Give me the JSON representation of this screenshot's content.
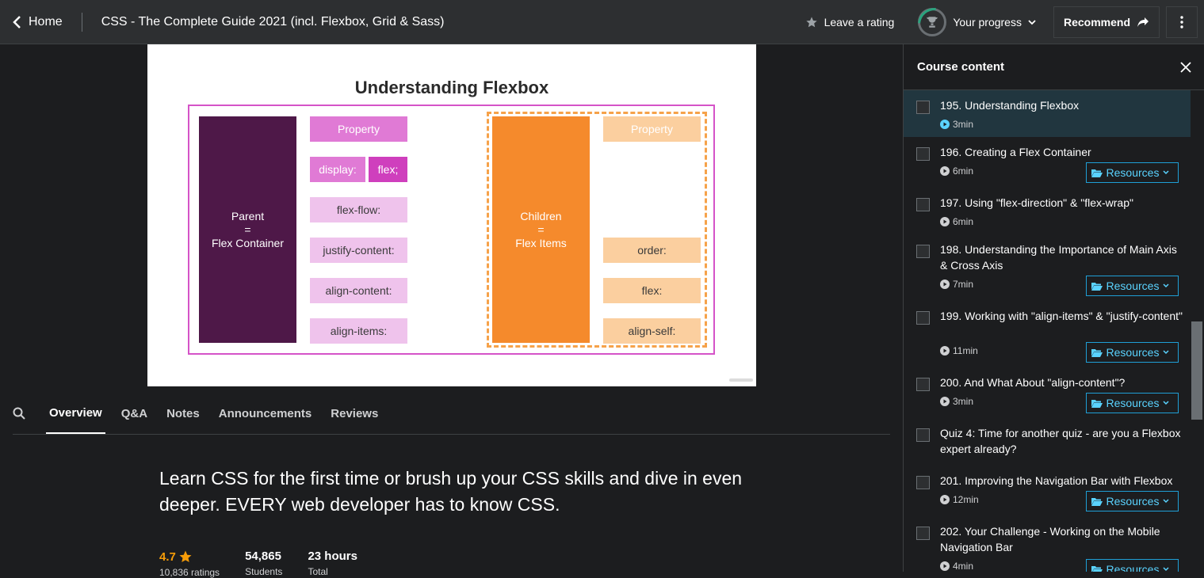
{
  "header": {
    "home_label": "Home",
    "course_title": "CSS - The Complete Guide 2021 (incl. Flexbox, Grid & Sass)",
    "rating_label": "Leave a rating",
    "progress_label": "Your progress",
    "recommend_label": "Recommend"
  },
  "slide": {
    "title": "Understanding Flexbox",
    "parent_line1": "Parent",
    "parent_line2": "=",
    "parent_line3": "Flex Container",
    "parent_property_header": "Property",
    "parent_props": [
      "display:",
      "flex;",
      "flex-flow:",
      "justify-content:",
      "align-content:",
      "align-items:"
    ],
    "children_line1": "Children",
    "children_line2": "=",
    "children_line3": "Flex Items",
    "children_property_header": "Property",
    "children_props": [
      "order:",
      "flex:",
      "align-self:"
    ]
  },
  "tabs": [
    "Overview",
    "Q&A",
    "Notes",
    "Announcements",
    "Reviews"
  ],
  "overview": {
    "headline": "Learn CSS for the first time or brush up your CSS skills and dive in even deeper. EVERY web developer has to know CSS.",
    "rating_value": "4.7",
    "rating_count": "10,836 ratings",
    "students_value": "54,865",
    "students_label": "Students",
    "hours_value": "23 hours",
    "hours_label": "Total"
  },
  "sidebar": {
    "title": "Course content",
    "resources_label": "Resources",
    "lectures": [
      {
        "title": "195. Understanding Flexbox",
        "duration": "3min"
      },
      {
        "title": "196. Creating a Flex Container",
        "duration": "6min"
      },
      {
        "title": "197. Using \"flex-direction\" & \"flex-wrap\"",
        "duration": "6min"
      },
      {
        "title": "198. Understanding the Importance of Main Axis & Cross Axis",
        "duration": "7min"
      },
      {
        "title": "199. Working with \"align-items\" & \"justify-content\"",
        "duration": "11min"
      },
      {
        "title": "200. And What About \"align-content\"?",
        "duration": "3min"
      },
      {
        "title": "Quiz 4: Time for another quiz - are you a Flexbox expert already?",
        "duration": ""
      },
      {
        "title": "201. Improving the Navigation Bar with Flexbox",
        "duration": "12min"
      },
      {
        "title": "202. Your Challenge - Working on the Mobile Navigation Bar",
        "duration": "4min"
      }
    ]
  },
  "colors": {
    "accent_blue": "#5ad3ff",
    "rating_orange": "#f69c08",
    "current_lecture_bg": "#21363f"
  }
}
